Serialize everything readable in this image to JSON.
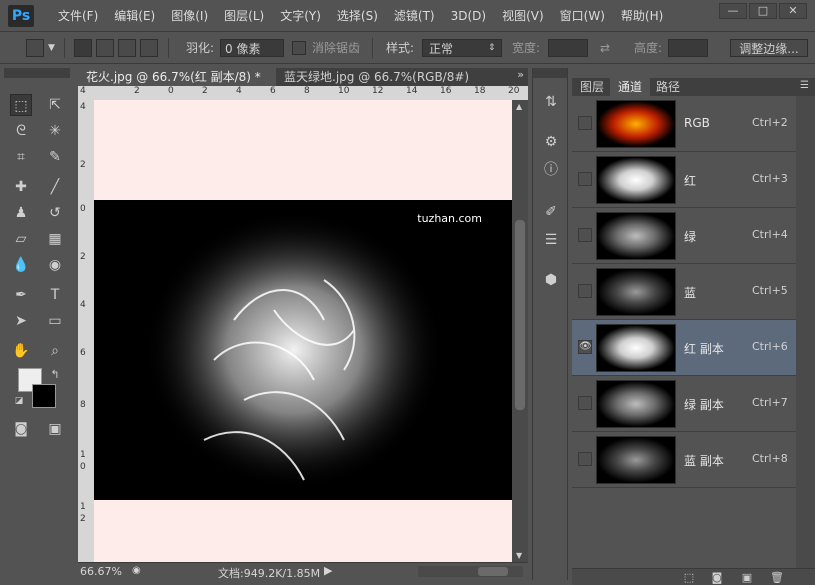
{
  "app": {
    "logo": "Ps",
    "menu": [
      "文件(F)",
      "编辑(E)",
      "图像(I)",
      "图层(L)",
      "文字(Y)",
      "选择(S)",
      "滤镜(T)",
      "3D(D)",
      "视图(V)",
      "窗口(W)",
      "帮助(H)"
    ],
    "window_controls": [
      "—",
      "□",
      "✕"
    ]
  },
  "options": {
    "feather_label": "羽化:",
    "feather_value": "0 像素",
    "antialias_label": "消除锯齿",
    "style_label": "样式:",
    "style_value": "正常",
    "width_label": "宽度:",
    "height_label": "高度:",
    "refine_button": "调整边缘..."
  },
  "tabs": [
    {
      "label": "花火.jpg @ 66.7%(红 副本/8) *",
      "close": "×",
      "active": true
    },
    {
      "label": "蓝天绿地.jpg @ 66.7%(RGB/8#)",
      "close": "×",
      "active": false
    }
  ],
  "rulers": {
    "horizontal": [
      "4",
      "2",
      "0",
      "2",
      "4",
      "6",
      "8",
      "10",
      "12",
      "14",
      "16",
      "18",
      "20"
    ],
    "vertical": [
      "4",
      "2",
      "0",
      "2",
      "4",
      "6",
      "8",
      "1",
      "0",
      "1",
      "2"
    ]
  },
  "canvas": {
    "watermark": "tuzhan.com"
  },
  "status": {
    "zoom": "66.67%",
    "doc_info": "文档:949.2K/1.85M"
  },
  "channels_panel": {
    "tabs": [
      "图层",
      "通道",
      "路径"
    ],
    "active_tab": "通道",
    "channels": [
      {
        "name": "RGB",
        "shortcut": "Ctrl+2",
        "thumb": "rgb",
        "visible": false,
        "selected": false
      },
      {
        "name": "红",
        "shortcut": "Ctrl+3",
        "thumb": "red",
        "visible": false,
        "selected": false
      },
      {
        "name": "绿",
        "shortcut": "Ctrl+4",
        "thumb": "green",
        "visible": false,
        "selected": false
      },
      {
        "name": "蓝",
        "shortcut": "Ctrl+5",
        "thumb": "blue",
        "visible": false,
        "selected": false
      },
      {
        "name": "红 副本",
        "shortcut": "Ctrl+6",
        "thumb": "red",
        "visible": true,
        "selected": true
      },
      {
        "name": "绿 副本",
        "shortcut": "Ctrl+7",
        "thumb": "green",
        "visible": false,
        "selected": false
      },
      {
        "name": "蓝 副本",
        "shortcut": "Ctrl+8",
        "thumb": "blue",
        "visible": false,
        "selected": false
      }
    ]
  },
  "colors": {
    "canvas_bg": "#fdecea",
    "selected_row": "#5d6a7c",
    "ui_bg": "#535353"
  }
}
